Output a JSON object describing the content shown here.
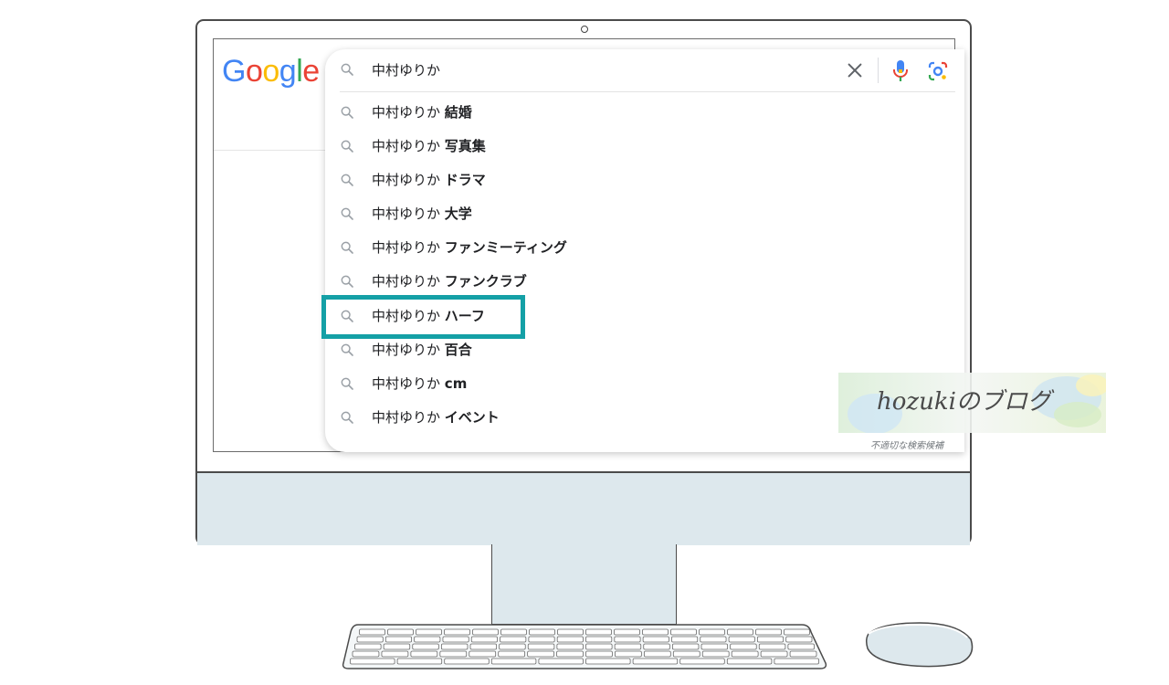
{
  "search": {
    "logo": [
      "G",
      "o",
      "o",
      "g",
      "l",
      "e"
    ],
    "query": "中村ゆりか",
    "suggestions": [
      {
        "base": "中村ゆりか",
        "bold": "結婚"
      },
      {
        "base": "中村ゆりか",
        "bold": "写真集"
      },
      {
        "base": "中村ゆりか",
        "bold": "ドラマ"
      },
      {
        "base": "中村ゆりか",
        "bold": "大学"
      },
      {
        "base": "中村ゆりか",
        "bold": "ファンミーティング"
      },
      {
        "base": "中村ゆりか",
        "bold": "ファンクラブ"
      },
      {
        "base": "中村ゆりか",
        "bold": "ハーフ"
      },
      {
        "base": "中村ゆりか",
        "bold": "百合"
      },
      {
        "base": "中村ゆりか",
        "bold": "cm"
      },
      {
        "base": "中村ゆりか",
        "bold": "イベント"
      }
    ],
    "report_link": "不適切な検索候補",
    "highlighted_index": 6
  },
  "watermark": {
    "text": "hozukiのブログ"
  },
  "colors": {
    "highlight": "#14a0a6",
    "monitor_chin": "#dde8ed",
    "google_blue": "#4285F4",
    "google_red": "#EA4335",
    "google_yellow": "#FBBC05",
    "google_green": "#34A853"
  },
  "icons": {
    "search": "magnifier-icon",
    "clear": "close-icon",
    "voice": "microphone-icon",
    "image_search": "google-lens-icon"
  }
}
